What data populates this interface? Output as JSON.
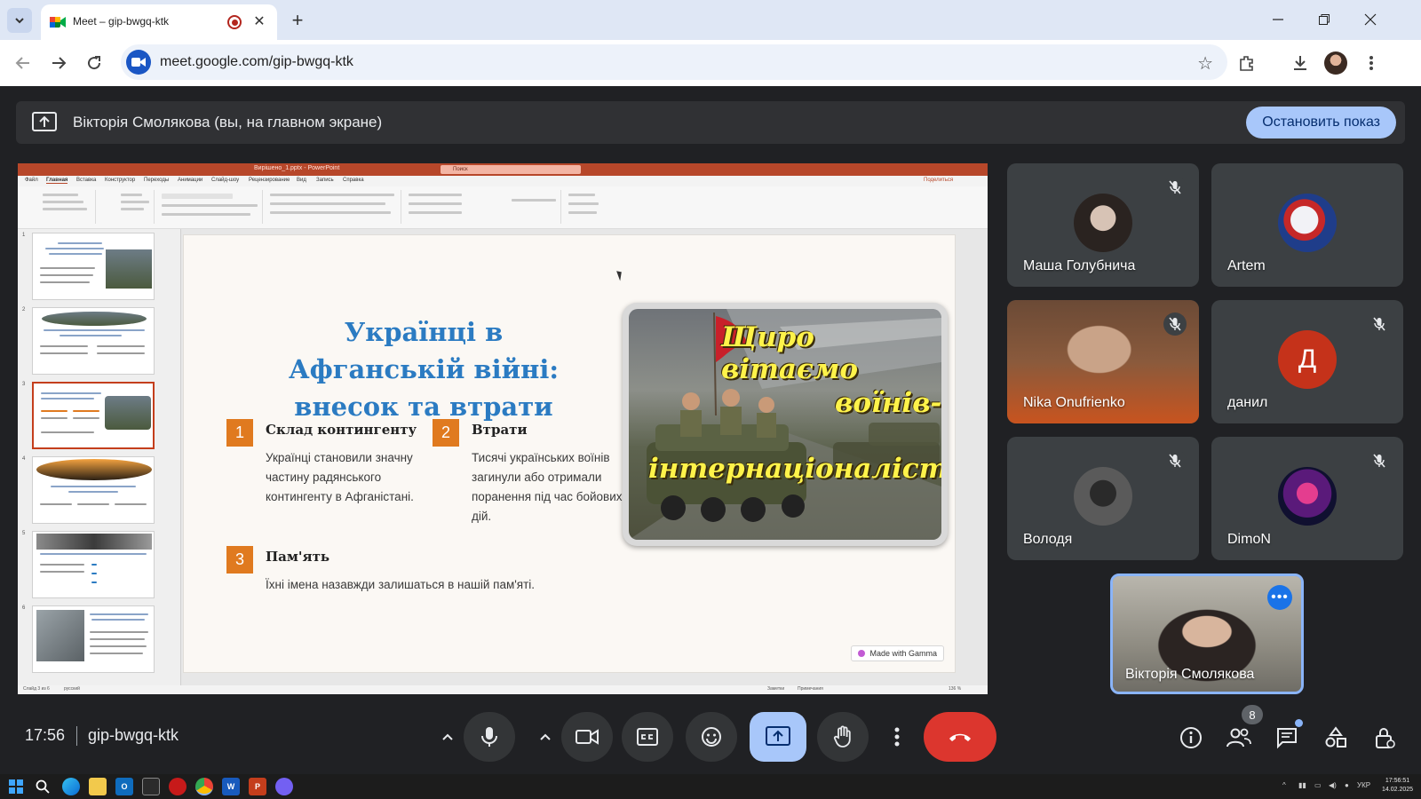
{
  "browser": {
    "tab_title": "Meet – gip-bwgq-ktk",
    "url": "meet.google.com/gip-bwgq-ktk"
  },
  "banner": {
    "text": "Вікторія Смолякова (вы, на главном экране)",
    "stop_button": "Остановить показ"
  },
  "shared_screen": {
    "ppt_window_title": "Вирішено_1.pptx - PowerPoint",
    "ppt_search": "Поиск",
    "ppt_share": "Поделиться",
    "ppt_menu": [
      "Файл",
      "Главная",
      "Вставка",
      "Конструктор",
      "Переходы",
      "Анимации",
      "Слайд-шоу",
      "Рецензирование",
      "Вид",
      "Запись",
      "Справка"
    ],
    "status_left": "Слайд 3 из 6",
    "status_lang": "русский",
    "status_notes": "Заметки",
    "status_comments": "Примечания",
    "status_zoom": "136 %",
    "slide_numbers": [
      "1",
      "2",
      "3",
      "4",
      "5",
      "6"
    ],
    "slide": {
      "title": "Українці в Афганській війні: внесок та втрати",
      "items": [
        {
          "num": "1",
          "heading": "Склад контингенту",
          "text": "Українці становили значну частину радянського контингенту в Афганістані."
        },
        {
          "num": "2",
          "heading": "Втрати",
          "text": "Тисячі українських воїнів загинули або отримали поранення під час бойових дій."
        },
        {
          "num": "3",
          "heading": "Пам'ять",
          "text": "Їхні імена назавжди залишаться в нашій пам'яті."
        }
      ],
      "image_caption_lines": [
        "Щиро вітаємо",
        "воїнів-",
        "інтернаціоналістів"
      ],
      "gamma_badge": "Made with Gamma"
    }
  },
  "participants": [
    {
      "name": "Маша Голубнича",
      "muted": true
    },
    {
      "name": "Artem",
      "muted": false
    },
    {
      "name": "Nika Onufrienko",
      "muted": true
    },
    {
      "name": "данил",
      "muted": true,
      "initial": "Д"
    },
    {
      "name": "Володя",
      "muted": true
    },
    {
      "name": "DimoN",
      "muted": true
    }
  ],
  "self_view": {
    "name": "Вікторія Смолякова"
  },
  "bottom_bar": {
    "time": "17:56",
    "meeting_code": "gip-bwgq-ktk",
    "participant_count": "8"
  },
  "taskbar": {
    "lang": "УКР",
    "clock_time": "17:56:51",
    "clock_date": "14.02.2025"
  },
  "colors": {
    "meet_bg": "#202124",
    "tile_bg": "#3c4043",
    "present_accent": "#a8c7fa",
    "leave_red": "#dc362e",
    "ppt_orange": "#b7472a",
    "slide_title_blue": "#2b7bc2",
    "slide_number_orange": "#e07a1f"
  },
  "icons": [
    "chevron-down-icon",
    "meet-favicon",
    "recording-icon",
    "close-icon",
    "plus-icon",
    "back-icon",
    "forward-icon",
    "reload-icon",
    "site-info-icon",
    "star-icon",
    "extensions-icon",
    "download-icon",
    "more-vert-icon",
    "present-icon",
    "mic-off-icon",
    "mic-icon",
    "camera-icon",
    "captions-icon",
    "emoji-icon",
    "raise-hand-icon",
    "call-end-icon",
    "info-icon",
    "people-icon",
    "chat-icon",
    "activities-icon",
    "host-controls-icon"
  ]
}
